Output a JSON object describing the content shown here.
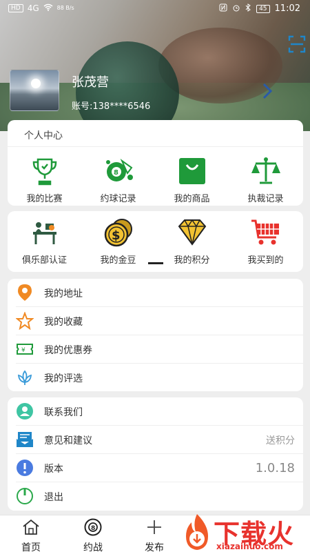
{
  "status_bar": {
    "left": [
      "HD",
      "4G",
      "88 B/s"
    ],
    "time": "11:02",
    "battery": "45"
  },
  "profile": {
    "name": "张茂营",
    "account": "账号:138****6546"
  },
  "personal_center": {
    "title": "个人中心",
    "items": [
      {
        "label": "我的比赛",
        "icon": "trophy-icon"
      },
      {
        "label": "约球记录",
        "icon": "billiard-record-icon"
      },
      {
        "label": "我的商品",
        "icon": "shopping-bag-icon"
      },
      {
        "label": "执裁记录",
        "icon": "scales-icon"
      }
    ]
  },
  "services": {
    "items": [
      {
        "label": "俱乐部认证",
        "icon": "club-verify-icon"
      },
      {
        "label": "我的金豆",
        "icon": "gold-coins-icon"
      },
      {
        "label": "我的积分",
        "icon": "diamond-icon"
      },
      {
        "label": "我买到的",
        "icon": "cart-icon"
      }
    ]
  },
  "menu_list_1": [
    {
      "label": "我的地址",
      "icon": "location-pin-icon"
    },
    {
      "label": "我的收藏",
      "icon": "star-icon"
    },
    {
      "label": "我的优惠券",
      "icon": "coupon-icon"
    },
    {
      "label": "我的评选",
      "icon": "lotus-icon"
    }
  ],
  "menu_list_2": [
    {
      "label": "联系我们",
      "icon": "contact-icon",
      "value": ""
    },
    {
      "label": "意见和建议",
      "icon": "feedback-icon",
      "value": "送积分"
    },
    {
      "label": "版本",
      "icon": "info-icon",
      "value": "1.0.18"
    },
    {
      "label": "退出",
      "icon": "power-icon",
      "value": ""
    }
  ],
  "bottom_nav": [
    {
      "label": "首页",
      "icon": "home-icon"
    },
    {
      "label": "约战",
      "icon": "billiard-ball-icon"
    },
    {
      "label": "发布",
      "icon": "plus-icon"
    }
  ],
  "watermark": {
    "text": "下载火",
    "url": "xiazaihuo.com"
  },
  "colors": {
    "green": "#1f9a3a",
    "orange": "#f08a24",
    "blue": "#1f86c8",
    "red": "#e8322d"
  }
}
